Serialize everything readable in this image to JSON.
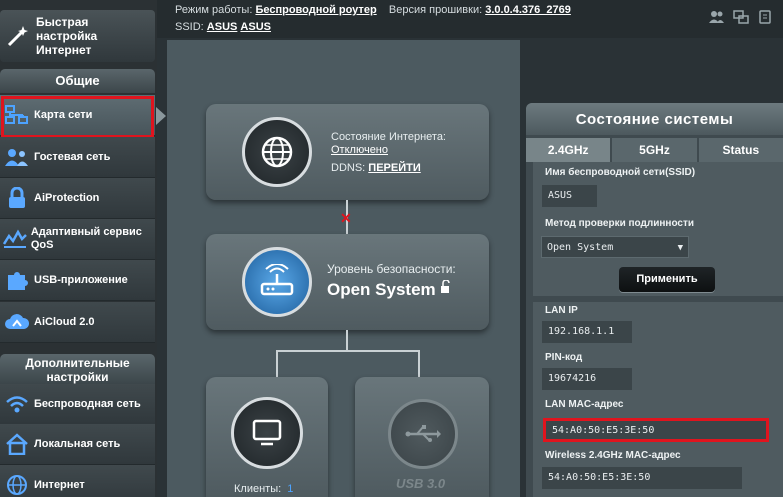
{
  "sidebar": {
    "quick_setup": "Быстрая настройка Интернет",
    "general_header": "Общие",
    "items": [
      {
        "label": "Карта сети",
        "icon": "network-map-icon"
      },
      {
        "label": "Гостевая сеть",
        "icon": "guest-network-icon"
      },
      {
        "label": "AiProtection",
        "icon": "lock-icon"
      },
      {
        "label": "Адаптивный сервис QoS",
        "icon": "qos-icon"
      },
      {
        "label": "USB-приложение",
        "icon": "puzzle-icon"
      },
      {
        "label": "AiCloud 2.0",
        "icon": "cloud-icon"
      }
    ],
    "advanced_header": "Дополнительные настройки",
    "advanced_items": [
      {
        "label": "Беспроводная сеть",
        "icon": "wifi-icon"
      },
      {
        "label": "Локальная сеть",
        "icon": "home-icon"
      },
      {
        "label": "Интернет",
        "icon": "globe-icon"
      }
    ]
  },
  "topbar": {
    "mode_label": "Режим работы:",
    "mode_value": "Беспроводной роутер",
    "firmware_label": "Версия прошивки:",
    "firmware_value": "3.0.0.4.376_2769",
    "ssid_label": "SSID:",
    "ssid_1": "ASUS",
    "ssid_2": "ASUS"
  },
  "map": {
    "internet_status_label": "Состояние Интернета:",
    "internet_status_value": "Отключено",
    "ddns_label": "DDNS:",
    "ddns_link": "ПЕРЕЙТИ",
    "security_label": "Уровень безопасности:",
    "security_value": "Open System",
    "clients_label": "Клиенты:",
    "clients_count": "1",
    "usb_label": "USB 3.0"
  },
  "status_panel": {
    "title": "Состояние системы",
    "tabs": [
      "2.4GHz",
      "5GHz",
      "Status"
    ],
    "ssid_label": "Имя беспроводной сети(SSID)",
    "ssid_value": "ASUS",
    "auth_label": "Метод проверки подлинности",
    "auth_value": "Open System",
    "apply_label": "Применить",
    "lan_ip_label": "LAN IP",
    "lan_ip_value": "192.168.1.1",
    "pin_label": "PIN-код",
    "pin_value": "19674216",
    "lan_mac_label": "LAN MAC-адрес",
    "lan_mac_value": "54:A0:50:E5:3E:50",
    "wl_mac_label": "Wireless 2.4GHz MAC-адрес",
    "wl_mac_value": "54:A0:50:E5:3E:50"
  },
  "colors": {
    "highlight": "#e0141e",
    "accent_blue": "#2e7fc6"
  }
}
